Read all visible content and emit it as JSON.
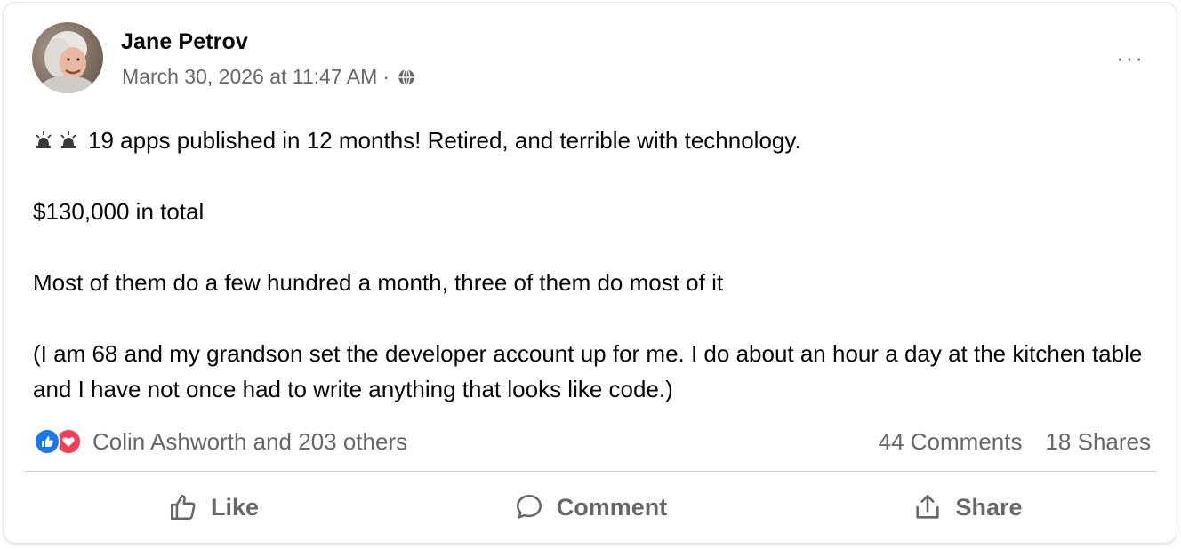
{
  "post": {
    "author": "Jane Petrov",
    "timestamp": "March 30, 2026 at 11:47 AM",
    "separator": "·",
    "privacy_icon": "globe-icon",
    "more_label": "···",
    "emoji_prefix": [
      "rotating-light-icon",
      "rotating-light-icon"
    ],
    "paragraphs": [
      "19 apps published in 12 months! Retired, and terrible with technology.",
      "$130,000 in total",
      "Most of them do a few hundred a month, three of them do most of it",
      "(I am 68 and my grandson set the developer account up for me. I do about an hour a day at the kitchen table and I have not once had to write anything that looks like code.)"
    ]
  },
  "stats": {
    "reaction_icons": [
      "like-reaction-icon",
      "love-reaction-icon"
    ],
    "reactors": "Colin Ashworth and 203 others",
    "comments": "44 Comments",
    "shares": "18 Shares"
  },
  "actions": {
    "like_label": "Like",
    "comment_label": "Comment",
    "share_label": "Share"
  },
  "colors": {
    "like_blue": "#1877f2",
    "love_red": "#f33e58",
    "secondary_text": "#65676b",
    "primary_text": "#050505"
  }
}
